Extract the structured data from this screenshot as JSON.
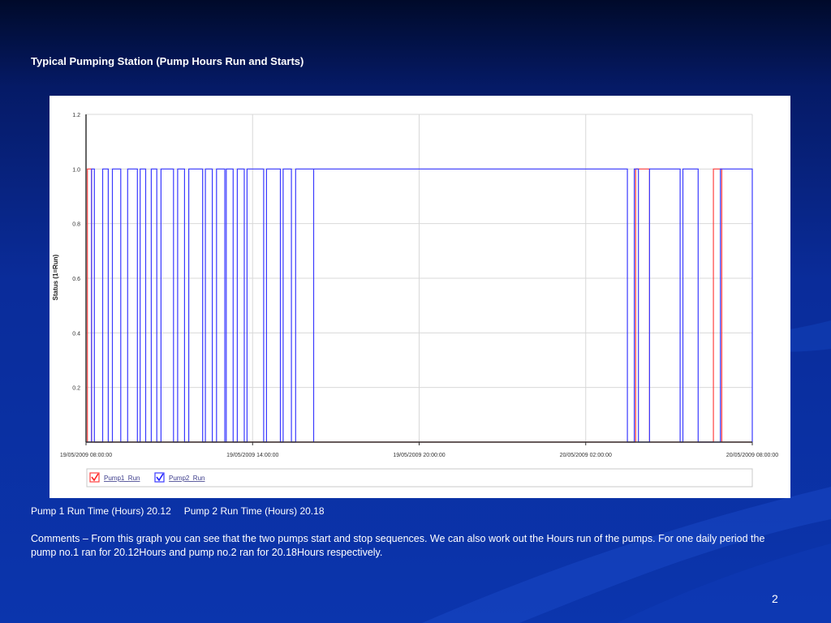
{
  "slide": {
    "title": "Typical Pumping Station (Pump Hours Run and Starts)",
    "pump1_stat": "Pump 1 Run Time (Hours) 20.12",
    "pump2_stat": "Pump 2 Run Time (Hours) 20.18",
    "comments": "Comments – From this graph you can see that the two pumps start and stop sequences. We can also work out the Hours run of the pumps. For one daily period the pump no.1 ran for 20.12Hours and pump no.2 ran for 20.18Hours respectively.",
    "page_number": "2"
  },
  "colors": {
    "pump1": "#ff4040",
    "pump2": "#3a3aff",
    "grid": "#d8d8d8",
    "axis": "#333333"
  },
  "chart_data": {
    "type": "line",
    "title": "",
    "ylabel": "Status (1=Run)",
    "xlabel": "",
    "ylim": [
      0,
      1.2
    ],
    "xlim": [
      0,
      24
    ],
    "y_ticks": [
      0.2,
      0.4,
      0.6,
      0.8,
      1.0,
      1.2
    ],
    "y_tick_labels": [
      "0.2",
      "0.4",
      "0.6",
      "0.8",
      "1.0",
      "1.2"
    ],
    "x_ticks": [
      0,
      6,
      12,
      18,
      24
    ],
    "x_tick_labels": [
      "19/05/2009 08:00:00",
      "19/05/2009 14:00:00",
      "19/05/2009 20:00:00",
      "20/05/2009 02:00:00",
      "20/05/2009 08:00:00"
    ],
    "x_units": "hours from 19/05/2009 08:00:00",
    "grid": true,
    "legend": {
      "position": "bottom",
      "items": [
        "Pump1_Run",
        "Pump2_Run"
      ]
    },
    "series": [
      {
        "name": "Pump1_Run",
        "step": true,
        "on_intervals": [
          [
            0.05,
            0.2
          ],
          [
            19.8,
            20.3
          ],
          [
            22.6,
            22.9
          ]
        ]
      },
      {
        "name": "Pump2_Run",
        "step": true,
        "on_intervals": [
          [
            0.2,
            0.3
          ],
          [
            0.6,
            0.8
          ],
          [
            0.95,
            1.25
          ],
          [
            1.5,
            1.85
          ],
          [
            1.95,
            2.15
          ],
          [
            2.35,
            2.55
          ],
          [
            2.7,
            3.15
          ],
          [
            3.3,
            3.55
          ],
          [
            3.7,
            4.2
          ],
          [
            4.3,
            4.55
          ],
          [
            4.7,
            5.0
          ],
          [
            5.05,
            5.3
          ],
          [
            5.45,
            5.7
          ],
          [
            5.8,
            6.4
          ],
          [
            6.5,
            7.0
          ],
          [
            7.1,
            7.4
          ],
          [
            7.55,
            8.2
          ],
          [
            8.2,
            19.5
          ],
          [
            19.75,
            19.9
          ],
          [
            20.3,
            21.4
          ],
          [
            21.5,
            22.05
          ],
          [
            22.85,
            24.0
          ]
        ]
      }
    ]
  }
}
